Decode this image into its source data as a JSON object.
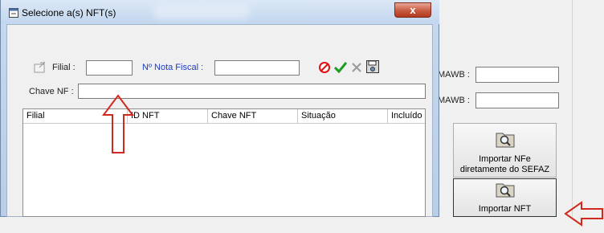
{
  "dialog": {
    "title": "Selecione a(s) NFT(s)",
    "close_label": "x",
    "filters": {
      "filial_label": "Filial :",
      "filial_value": "",
      "nota_fiscal_label": "Nº Nota Fiscal :",
      "nota_fiscal_value": "",
      "chave_label": "Chave NF :",
      "chave_value": ""
    },
    "grid": {
      "columns": [
        "Filial",
        "ID NFT",
        "Chave NFT",
        "Situação",
        "Incluído"
      ],
      "rows": []
    }
  },
  "background_panel": {
    "mawb_label_1": "MAWB :",
    "mawb_label_2": "MAWB :",
    "mawb_value_1": "",
    "mawb_value_2": "",
    "import_sefaz_label_1": "Importar NFe",
    "import_sefaz_label_2": "diretamente do SEFAZ",
    "import_nft_label": "Importar NFT"
  },
  "colors": {
    "annotation_arrow": "#d02a1e",
    "nota_fiscal_label": "#1a3cc8",
    "title_gradient_top": "#dbe8f6",
    "close_button": "#c75a41"
  },
  "icons": [
    "window-app-icon",
    "edit-file-icon",
    "cancel-icon",
    "check-icon",
    "clear-icon",
    "save-icon",
    "folder-search-icon"
  ]
}
